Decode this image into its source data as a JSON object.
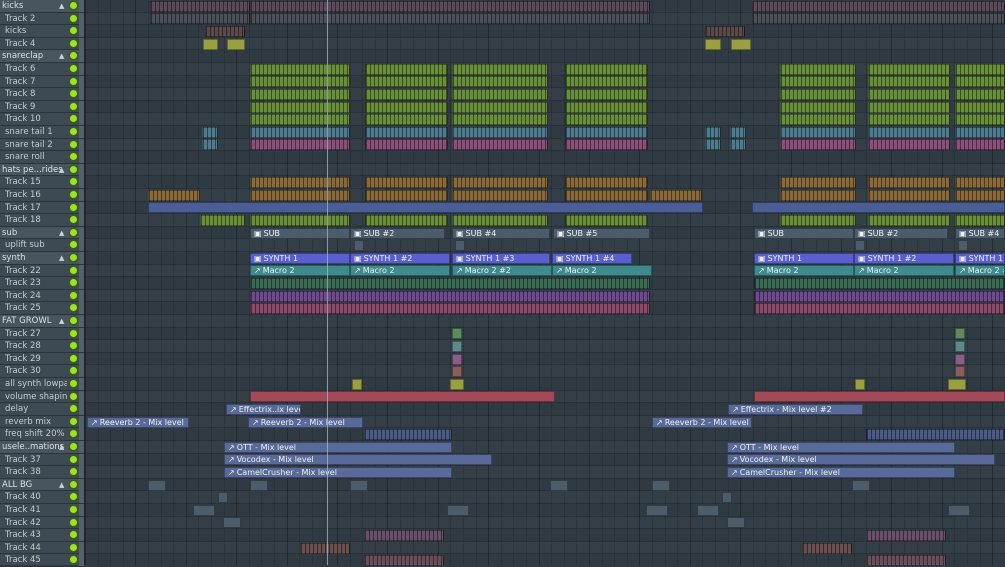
{
  "tracks": [
    {
      "name": "kicks",
      "group": true
    },
    {
      "name": "Track 2"
    },
    {
      "name": "kicks"
    },
    {
      "name": "Track 4"
    },
    {
      "name": "snareclap",
      "group": true
    },
    {
      "name": "Track 6"
    },
    {
      "name": "Track 7"
    },
    {
      "name": "Track 8"
    },
    {
      "name": "Track 9"
    },
    {
      "name": "Track 10"
    },
    {
      "name": "snare tail 1"
    },
    {
      "name": "snare tail 2"
    },
    {
      "name": "snare roll"
    },
    {
      "name": "hats pe...rides",
      "group": true
    },
    {
      "name": "Track 15"
    },
    {
      "name": "Track 16"
    },
    {
      "name": "Track 17"
    },
    {
      "name": "Track 18"
    },
    {
      "name": "sub",
      "group": true
    },
    {
      "name": "uplift sub"
    },
    {
      "name": "synth",
      "group": true
    },
    {
      "name": "Track 22"
    },
    {
      "name": "Track 23"
    },
    {
      "name": "Track 24"
    },
    {
      "name": "Track 25"
    },
    {
      "name": "FAT GROWL",
      "group": true
    },
    {
      "name": "Track 27"
    },
    {
      "name": "Track 28"
    },
    {
      "name": "Track 29"
    },
    {
      "name": "Track 30"
    },
    {
      "name": "all synth lowpass"
    },
    {
      "name": "volume shaping"
    },
    {
      "name": "delay"
    },
    {
      "name": "reverb mix"
    },
    {
      "name": "freq shift 20%"
    },
    {
      "name": "usele..mations",
      "group": true
    },
    {
      "name": "Track 37"
    },
    {
      "name": "Track 38"
    },
    {
      "name": "ALL BG",
      "group": true
    },
    {
      "name": "Track 40"
    },
    {
      "name": "Track 41"
    },
    {
      "name": "Track 42"
    },
    {
      "name": "Track 43"
    },
    {
      "name": "Track 44"
    },
    {
      "name": "Track 45"
    }
  ],
  "labels": {
    "sub1": "SUB",
    "sub2": "SUB #2",
    "sub3": "SUB #4",
    "sub4": "SUB #5",
    "sub5": "SUB",
    "sub6": "SUB #2",
    "sub7": "SUB #4",
    "syn1": "SYNTH 1",
    "syn2": "SYNTH 1 #2",
    "syn3": "SYNTH 1 #3",
    "syn4": "SYNTH 1 #4",
    "syn5": "SYNTH 1",
    "syn6": "SYNTH 1 #2",
    "syn7": "SYNTH 1 #",
    "mac1": "Macro 2",
    "mac2": "Macro 2",
    "mac3": "Macro 2 #2",
    "mac4": "Macro 2",
    "mac5": "Macro 2",
    "mac6": "Macro 2",
    "mac7": "Macro 2 #2",
    "eff1": "Effectrix..ix level",
    "eff2": "Effectrix - Mix level #2",
    "rev1": "Reeverb 2 - Mix level",
    "rev2": "Reeverb 2 - Mix level",
    "rev3": "Reeverb 2 - Mix level",
    "ott1": "OTT - Mix level",
    "ott2": "OTT - Mix level",
    "voc1": "Vocodex - Mix level",
    "voc2": "Vocodex - Mix level",
    "cam1": "CamelCrusher - Mix level",
    "cam2": "CamelCrusher - Mix level"
  },
  "colors": {
    "panel_bg": "#3d4a53",
    "grid_bg": "#2f3a42",
    "led_on": "#9be22b",
    "blue_clip": "#5a5fd0",
    "purple_clip": "#6d5bb8",
    "teal_clip": "#3f8a8c",
    "green_clip": "#6a8f3a",
    "orange_clip": "#8a6a3a",
    "red_clip": "#a34a5a",
    "auto_clip": "#5a6a98",
    "pale_clip": "#4d5c6a"
  }
}
